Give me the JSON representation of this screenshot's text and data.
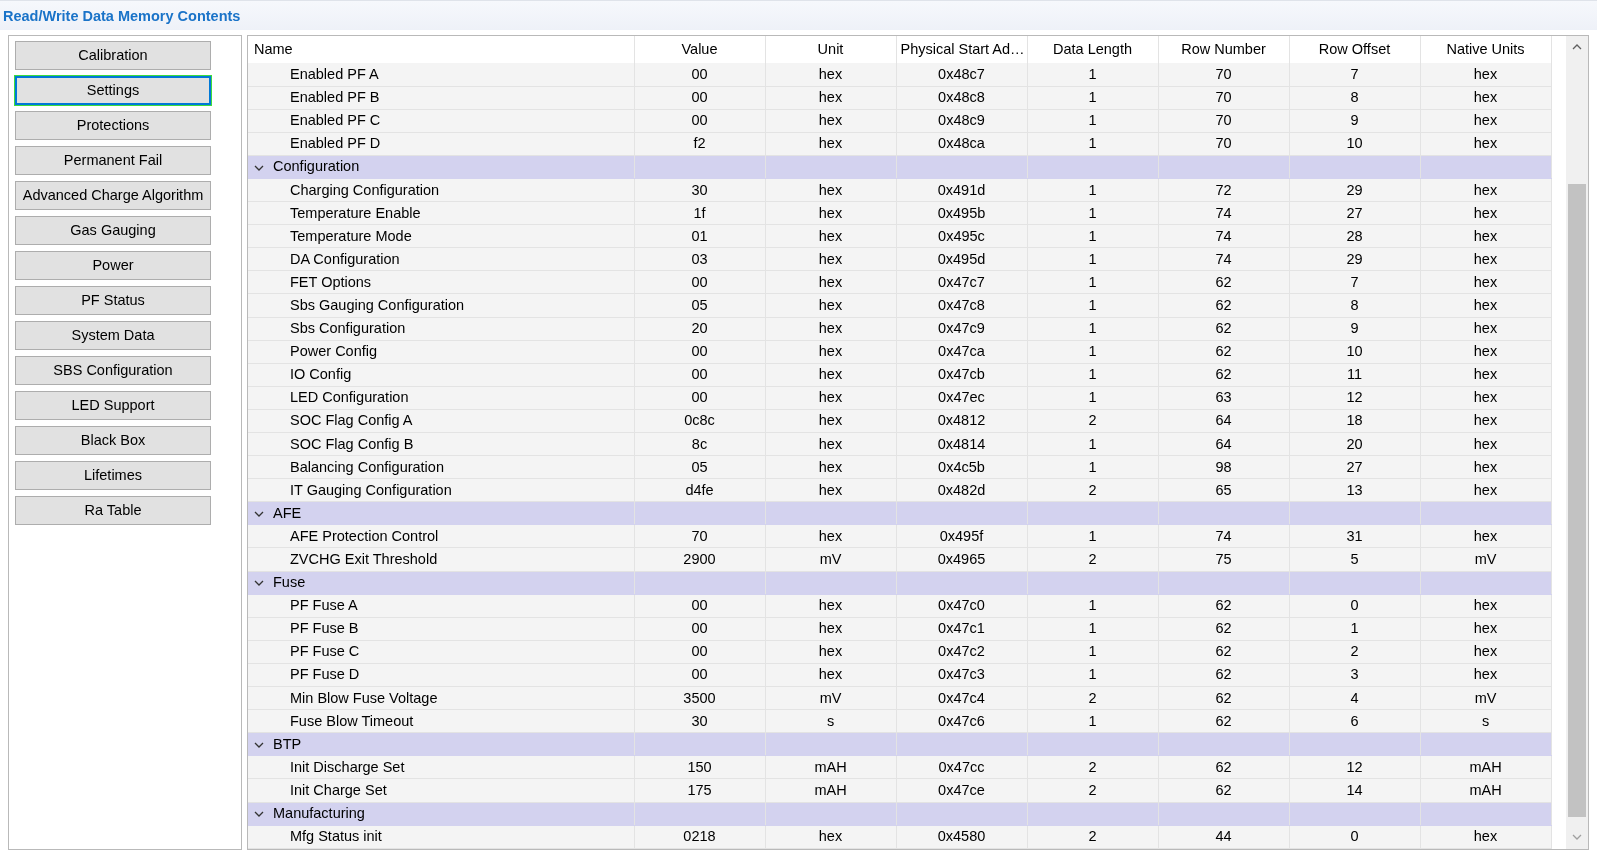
{
  "window": {
    "title": "Read/Write Data Memory Contents"
  },
  "sidebar": {
    "items": [
      {
        "label": "Calibration",
        "selected": false
      },
      {
        "label": "Settings",
        "selected": true
      },
      {
        "label": "Protections",
        "selected": false
      },
      {
        "label": "Permanent Fail",
        "selected": false
      },
      {
        "label": "Advanced Charge Algorithm",
        "selected": false
      },
      {
        "label": "Gas Gauging",
        "selected": false
      },
      {
        "label": "Power",
        "selected": false
      },
      {
        "label": "PF Status",
        "selected": false
      },
      {
        "label": "System Data",
        "selected": false
      },
      {
        "label": "SBS Configuration",
        "selected": false
      },
      {
        "label": "LED Support",
        "selected": false
      },
      {
        "label": "Black Box",
        "selected": false
      },
      {
        "label": "Lifetimes",
        "selected": false
      },
      {
        "label": "Ra Table",
        "selected": false
      }
    ]
  },
  "table": {
    "columns": [
      "Name",
      "Value",
      "Unit",
      "Physical Start Ad…",
      "Data Length",
      "Row Number",
      "Row Offset",
      "Native Units"
    ],
    "rows": [
      {
        "kind": "item",
        "cells": [
          "Enabled PF A",
          "00",
          "hex",
          "0x48c7",
          "1",
          "70",
          "7",
          "hex"
        ]
      },
      {
        "kind": "item",
        "cells": [
          "Enabled PF B",
          "00",
          "hex",
          "0x48c8",
          "1",
          "70",
          "8",
          "hex"
        ]
      },
      {
        "kind": "item",
        "cells": [
          "Enabled PF C",
          "00",
          "hex",
          "0x48c9",
          "1",
          "70",
          "9",
          "hex"
        ]
      },
      {
        "kind": "item",
        "cells": [
          "Enabled PF D",
          "f2",
          "hex",
          "0x48ca",
          "1",
          "70",
          "10",
          "hex"
        ]
      },
      {
        "kind": "group",
        "name": "Configuration",
        "expanded": true
      },
      {
        "kind": "item",
        "cells": [
          "Charging Configuration",
          "30",
          "hex",
          "0x491d",
          "1",
          "72",
          "29",
          "hex"
        ]
      },
      {
        "kind": "item",
        "cells": [
          "Temperature Enable",
          "1f",
          "hex",
          "0x495b",
          "1",
          "74",
          "27",
          "hex"
        ]
      },
      {
        "kind": "item",
        "cells": [
          "Temperature Mode",
          "01",
          "hex",
          "0x495c",
          "1",
          "74",
          "28",
          "hex"
        ]
      },
      {
        "kind": "item",
        "cells": [
          "DA Configuration",
          "03",
          "hex",
          "0x495d",
          "1",
          "74",
          "29",
          "hex"
        ]
      },
      {
        "kind": "item",
        "cells": [
          "FET Options",
          "00",
          "hex",
          "0x47c7",
          "1",
          "62",
          "7",
          "hex"
        ]
      },
      {
        "kind": "item",
        "cells": [
          "Sbs Gauging Configuration",
          "05",
          "hex",
          "0x47c8",
          "1",
          "62",
          "8",
          "hex"
        ]
      },
      {
        "kind": "item",
        "cells": [
          "Sbs Configuration",
          "20",
          "hex",
          "0x47c9",
          "1",
          "62",
          "9",
          "hex"
        ]
      },
      {
        "kind": "item",
        "cells": [
          "Power Config",
          "00",
          "hex",
          "0x47ca",
          "1",
          "62",
          "10",
          "hex"
        ]
      },
      {
        "kind": "item",
        "cells": [
          "IO Config",
          "00",
          "hex",
          "0x47cb",
          "1",
          "62",
          "11",
          "hex"
        ]
      },
      {
        "kind": "item",
        "cells": [
          "LED Configuration",
          "00",
          "hex",
          "0x47ec",
          "1",
          "63",
          "12",
          "hex"
        ]
      },
      {
        "kind": "item",
        "cells": [
          "SOC Flag Config A",
          "0c8c",
          "hex",
          "0x4812",
          "2",
          "64",
          "18",
          "hex"
        ]
      },
      {
        "kind": "item",
        "cells": [
          "SOC Flag Config B",
          "8c",
          "hex",
          "0x4814",
          "1",
          "64",
          "20",
          "hex"
        ]
      },
      {
        "kind": "item",
        "cells": [
          "Balancing Configuration",
          "05",
          "hex",
          "0x4c5b",
          "1",
          "98",
          "27",
          "hex"
        ]
      },
      {
        "kind": "item",
        "cells": [
          "IT Gauging Configuration",
          "d4fe",
          "hex",
          "0x482d",
          "2",
          "65",
          "13",
          "hex"
        ]
      },
      {
        "kind": "group",
        "name": "AFE",
        "expanded": true
      },
      {
        "kind": "item",
        "cells": [
          "AFE Protection Control",
          "70",
          "hex",
          "0x495f",
          "1",
          "74",
          "31",
          "hex"
        ]
      },
      {
        "kind": "item",
        "cells": [
          "ZVCHG Exit Threshold",
          "2900",
          "mV",
          "0x4965",
          "2",
          "75",
          "5",
          "mV"
        ]
      },
      {
        "kind": "group",
        "name": "Fuse",
        "expanded": true
      },
      {
        "kind": "item",
        "cells": [
          "PF Fuse A",
          "00",
          "hex",
          "0x47c0",
          "1",
          "62",
          "0",
          "hex"
        ]
      },
      {
        "kind": "item",
        "cells": [
          "PF Fuse B",
          "00",
          "hex",
          "0x47c1",
          "1",
          "62",
          "1",
          "hex"
        ]
      },
      {
        "kind": "item",
        "cells": [
          "PF Fuse C",
          "00",
          "hex",
          "0x47c2",
          "1",
          "62",
          "2",
          "hex"
        ]
      },
      {
        "kind": "item",
        "cells": [
          "PF Fuse D",
          "00",
          "hex",
          "0x47c3",
          "1",
          "62",
          "3",
          "hex"
        ]
      },
      {
        "kind": "item",
        "cells": [
          "Min Blow Fuse Voltage",
          "3500",
          "mV",
          "0x47c4",
          "2",
          "62",
          "4",
          "mV"
        ]
      },
      {
        "kind": "item",
        "cells": [
          "Fuse Blow Timeout",
          "30",
          "s",
          "0x47c6",
          "1",
          "62",
          "6",
          "s"
        ]
      },
      {
        "kind": "group",
        "name": "BTP",
        "expanded": true
      },
      {
        "kind": "item",
        "cells": [
          "Init Discharge Set",
          "150",
          "mAH",
          "0x47cc",
          "2",
          "62",
          "12",
          "mAH"
        ]
      },
      {
        "kind": "item",
        "cells": [
          "Init Charge Set",
          "175",
          "mAH",
          "0x47ce",
          "2",
          "62",
          "14",
          "mAH"
        ]
      },
      {
        "kind": "group",
        "name": "Manufacturing",
        "expanded": true
      },
      {
        "kind": "item",
        "cells": [
          "Mfg Status init",
          "0218",
          "hex",
          "0x4580",
          "2",
          "44",
          "0",
          "hex"
        ]
      }
    ]
  }
}
